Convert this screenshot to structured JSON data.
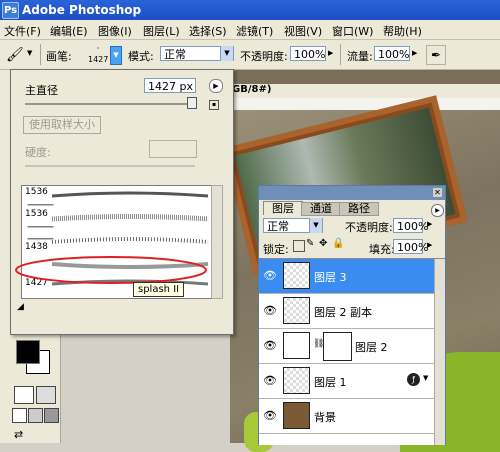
{
  "app": {
    "title": "Adobe Photoshop",
    "logo_letter": "Ps"
  },
  "menu": [
    "文件(F)",
    "编辑(E)",
    "图像(I)",
    "图层(L)",
    "选择(S)",
    "滤镜(T)",
    "视图(V)",
    "窗口(W)",
    "帮助(H)"
  ],
  "options": {
    "brush_label": "画笔:",
    "brush_size": "1427",
    "mode_label": "模式:",
    "mode_value": "正常",
    "opacity_label": "不透明度:",
    "opacity_value": "100%",
    "flow_label": "流量:",
    "flow_value": "100%"
  },
  "canvas": {
    "tab_suffix": "GB/8#)"
  },
  "brush_popup": {
    "diameter_label": "主直径",
    "diameter_value": "1427 px",
    "use_sample_label": "使用取样大小",
    "hardness_label": "硬度:",
    "presets": [
      "1536",
      "1536",
      "1438",
      "1427"
    ],
    "tooltip": "splash II"
  },
  "layers_panel": {
    "tabs": [
      "图层",
      "通道",
      "路径"
    ],
    "blend_mode": "正常",
    "opacity_label": "不透明度:",
    "opacity_value": "100%",
    "lock_label": "锁定:",
    "fill_label": "填充:",
    "fill_value": "100%",
    "layers": [
      {
        "name": "图层 3",
        "selected": true
      },
      {
        "name": "图层 2 副本",
        "selected": false
      },
      {
        "name": "图层 2",
        "selected": false
      },
      {
        "name": "图层 1",
        "selected": false
      },
      {
        "name": "背景",
        "selected": false
      }
    ]
  },
  "colors": {
    "selection": "#3b8cf0",
    "title": "#1c4fc4",
    "highlight_ellipse": "#e02020"
  }
}
